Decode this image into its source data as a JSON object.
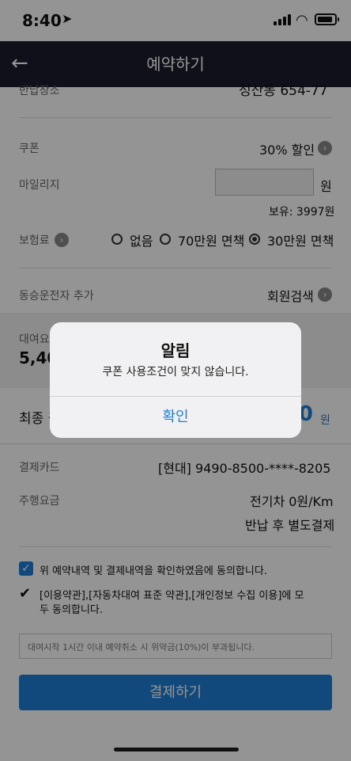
{
  "status_bar": {
    "time": "8:40",
    "location_icon": "location-arrow-icon",
    "signal_icon": "signal-icon",
    "wifi_icon": "wifi-icon",
    "battery_icon": "battery-icon"
  },
  "header": {
    "title": "예약하기",
    "back_icon": "arrow-left-icon"
  },
  "form": {
    "partial_label": "반납장소",
    "partial_value": "성산동 654-77",
    "coupon_label": "쿠폰",
    "coupon_value": "30% 할인",
    "mileage_label": "마일리지",
    "mileage_input_value": "",
    "mileage_unit": "원",
    "mileage_balance": "보유: 3997원",
    "insurance_label": "보험료",
    "insurance_options": [
      "없음",
      "70만원 면책",
      "30만원 면책"
    ],
    "insurance_selected": "30만원 면책",
    "co_driver_label": "동승운전자 추가",
    "co_driver_value": "회원검색",
    "rental_fee_label": "대여요금",
    "rental_fee_value": "5,40",
    "final_label": "최종 결",
    "final_value": ".0",
    "final_unit": "원",
    "card_label": "결제카드",
    "card_value": "[현대] 9490-8500-****-8205",
    "drive_fee_label": "주행요금",
    "drive_fee_value": "전기차 0원/Km",
    "drive_fee_note": "반납 후 별도결제",
    "agree1": "위 예약내역 및 결제내역을 확인하였음에 동의합니다.",
    "agree2_line1": "[이용약관],[자동차대여 표준 약관],[개인정보 수집 이용]에 모",
    "agree2_line2": "두 동의합니다.",
    "cancel_notice": "대여시작 1시간 이내 예약취소 시 위약금(10%)이 부과됩니다.",
    "pay_button": "결제하기"
  },
  "dialog": {
    "title": "알림",
    "message": "쿠폰 사용조건이 맞지 않습니다.",
    "confirm": "확인"
  },
  "colors": {
    "header_bg": "#1a1d2e",
    "accent": "#1e7fd8"
  }
}
